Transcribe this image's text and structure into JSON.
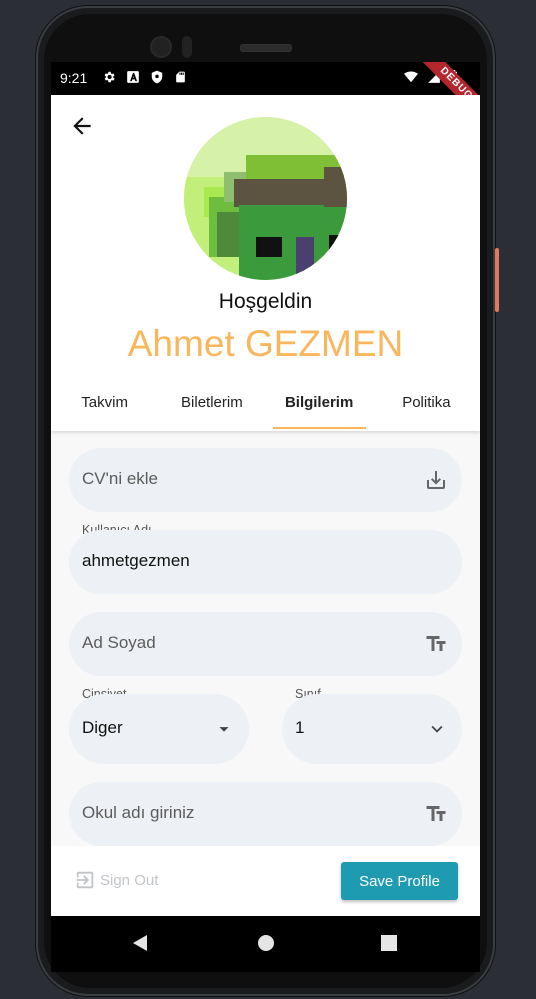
{
  "status_bar": {
    "time": "9:21",
    "left_icons": [
      "settings-icon",
      "a-icon",
      "shield-icon",
      "sdcard-icon"
    ],
    "right_icons": [
      "wifi-icon",
      "signal-icon",
      "battery-icon"
    ],
    "debug_banner": "DEBUG"
  },
  "header": {
    "welcome_text": "Hoşgeldin",
    "user_name": "Ahmet GEZMEN",
    "accent_color": "#f9b65b"
  },
  "tabs": [
    {
      "label": "Takvim",
      "active": false
    },
    {
      "label": "Biletlerim",
      "active": false
    },
    {
      "label": "Bilgilerim",
      "active": true
    },
    {
      "label": "Politika",
      "active": false
    }
  ],
  "form": {
    "cv": {
      "placeholder": "CV'ni ekle",
      "icon": "download-icon"
    },
    "username": {
      "label": "Kullanıcı Adı",
      "value": "ahmetgezmen"
    },
    "fullname": {
      "placeholder": "Ad Soyad",
      "icon": "text-fields-icon"
    },
    "gender": {
      "label": "Cinsiyet",
      "value": "Diger",
      "icon": "arrow-drop-down-icon"
    },
    "grade": {
      "label": "Sınıf",
      "value": "1",
      "icon": "chevron-down-icon"
    },
    "school": {
      "placeholder": "Okul adı giriniz",
      "icon": "text-fields-icon"
    }
  },
  "bottom_bar": {
    "sign_out_label": "Sign Out",
    "save_label": "Save Profile",
    "save_color": "#1e9bb1"
  },
  "nav_bar": [
    "back-icon",
    "home-icon",
    "recents-icon"
  ]
}
